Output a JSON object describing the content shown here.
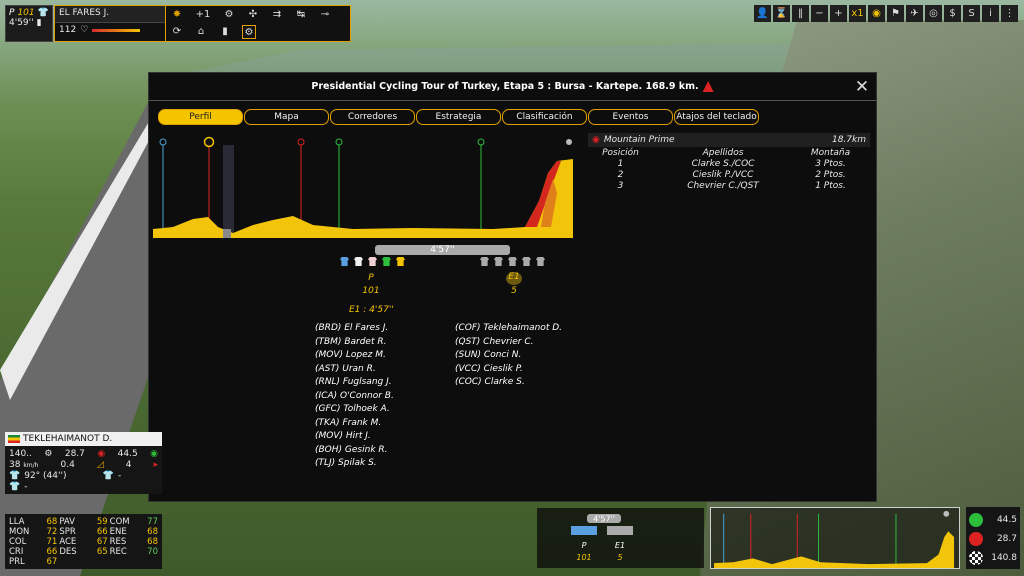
{
  "rider_hud": {
    "group_letter": "P",
    "group_count": "101",
    "gap": "4'59''",
    "name": "EL FARES J.",
    "plus": "+1",
    "energy": "112"
  },
  "dialog": {
    "title": "Presidential Cycling Tour of Turkey, Etapa 5 : Bursa - Kartepe. 168.9 km.",
    "tabs": [
      "Perfil",
      "Mapa",
      "Corredores",
      "Estrategia",
      "Clasificación",
      "Eventos",
      "Atajos del teclado"
    ],
    "active_tab": 0
  },
  "mountain_prime": {
    "title": "Mountain Prime",
    "distance": "18.7km",
    "headers": [
      "Posición",
      "Apellidos",
      "Montaña"
    ],
    "rows": [
      [
        "1",
        "Clarke S./COC",
        "3 Ptos."
      ],
      [
        "2",
        "Cieslik P./VCC",
        "2 Ptos."
      ],
      [
        "3",
        "Chevrier C./QST",
        "1 Ptos."
      ]
    ]
  },
  "groups": {
    "gap_bar": "4'57''",
    "p_label": "P",
    "p_count": "101",
    "e1_label": "E1",
    "e1_count": "5",
    "summary": "E1 : 4'57''"
  },
  "riders_p": [
    "(BRD) El Fares J.",
    "(TBM) Bardet R.",
    "(MOV) Lopez M.",
    "(AST) Uran R.",
    "(RNL) Fuglsang J.",
    "(ICA) O'Connor B.",
    "(GFC) Tolhoek A.",
    "(TKA) Frank M.",
    "(MOV) Hirt J.",
    "(BOH) Gesink R.",
    "(TLJ) Spilak S."
  ],
  "riders_e1": [
    "(COF) Teklehaimanot D.",
    "(QST) Chevrier C.",
    "(SUN) Conci N.",
    "(VCC) Cieslik P.",
    "(COC) Clarke S."
  ],
  "selected_rider": {
    "name": "TEKLEHAIMANOT D.",
    "speed": "140..",
    "v1": "28.7",
    "v2": "44.5",
    "kmh": "38",
    "kmh_unit": "km/h",
    "v3": "0.4",
    "v4": "4",
    "jersey_text": "92° (44'')",
    "green_text": "-",
    "polka_text": "-"
  },
  "attributes": [
    [
      "LLA",
      "68"
    ],
    [
      "PAV",
      "59"
    ],
    [
      "COM",
      "77"
    ],
    [
      "MON",
      "72"
    ],
    [
      "SPR",
      "66"
    ],
    [
      "ENE",
      "68"
    ],
    [
      "COL",
      "71"
    ],
    [
      "ACE",
      "67"
    ],
    [
      "RES",
      "68"
    ],
    [
      "CRI",
      "66"
    ],
    [
      "DES",
      "65"
    ],
    [
      "REC",
      "70"
    ],
    [
      "PRL",
      "67"
    ]
  ],
  "mini_groups": {
    "gap": "4'57''",
    "p_label": "P",
    "e1_label": "E1",
    "p_count": "101",
    "e1_count": "5"
  },
  "stage_stats": {
    "sprint_km": "44.5",
    "climb_km": "28.7",
    "finish_km": "140.8"
  },
  "colors": {
    "accent": "#f5c400",
    "attr_green": "#5fd35f",
    "profile_fill": "#f2c40a"
  }
}
